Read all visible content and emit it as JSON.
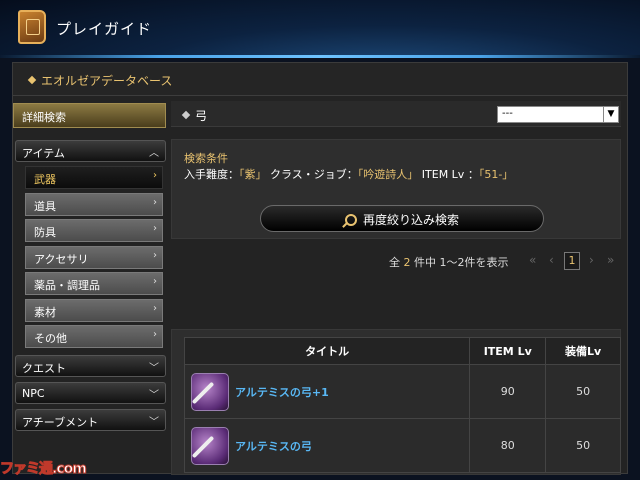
{
  "header": {
    "title": "プレイガイド"
  },
  "database": {
    "title": "エオルゼアデータベース"
  },
  "nav": {
    "detail_search": "詳細検索",
    "categories": [
      {
        "label": "アイテム"
      },
      {
        "label": "クエスト"
      },
      {
        "label": "NPC"
      },
      {
        "label": "アチーブメント"
      }
    ],
    "items": [
      {
        "label": "武器"
      },
      {
        "label": "道具"
      },
      {
        "label": "防具"
      },
      {
        "label": "アクセサリ"
      },
      {
        "label": "薬品・調理品"
      },
      {
        "label": "素材"
      },
      {
        "label": "その他"
      }
    ]
  },
  "filter": {
    "label": "弓",
    "select_value": "---"
  },
  "conditions": {
    "heading": "検索条件",
    "difficulty_label": "入手難度：",
    "difficulty_value": "「紫」",
    "class_label": "クラス・ジョブ：",
    "class_value": "「吟遊詩人」",
    "level_label": "ITEM Lv ：",
    "level_value": "「51-」"
  },
  "search_button": "再度絞り込み検索",
  "pager": {
    "prefix": "全",
    "total": "2",
    "middle": "件中 1〜2件を表示",
    "page": "1",
    "first": "«",
    "prev": "‹",
    "next": "›",
    "last": "»"
  },
  "table": {
    "headers": [
      "タイトル",
      "ITEM Lv",
      "装備Lv"
    ],
    "rows": [
      {
        "title": "アルテミスの弓+1",
        "item_lv": "90",
        "equip_lv": "50"
      },
      {
        "title": "アルテミスの弓",
        "item_lv": "80",
        "equip_lv": "50"
      }
    ]
  },
  "watermark": "ファミ通.com"
}
